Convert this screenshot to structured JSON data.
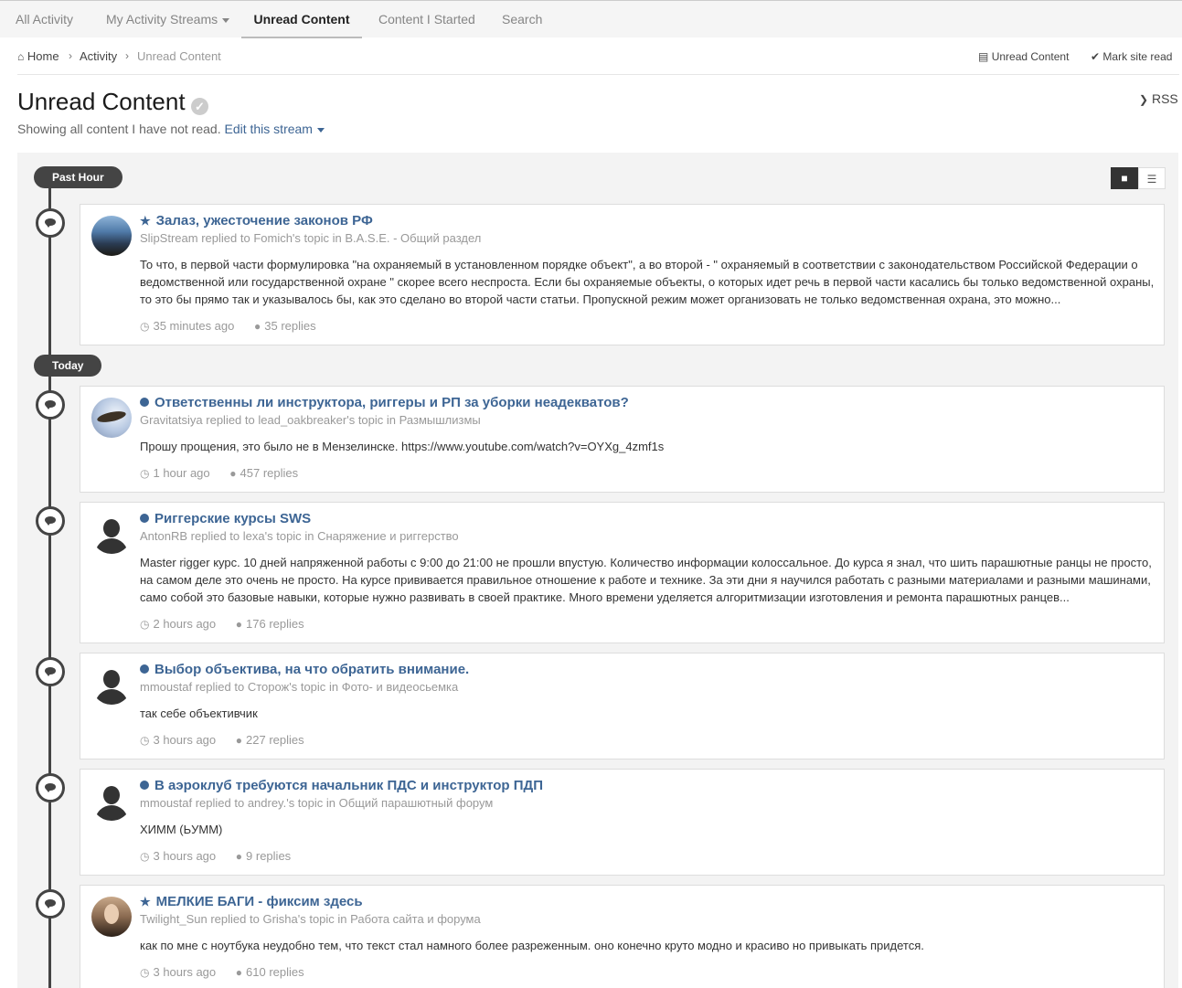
{
  "tabs": [
    {
      "label": "All Activity"
    },
    {
      "label": "My Activity Streams"
    },
    {
      "label": "Unread Content"
    },
    {
      "label": "Content I Started"
    },
    {
      "label": "Search"
    }
  ],
  "breadcrumb": {
    "home": "Home",
    "activity": "Activity",
    "current": "Unread Content",
    "unread_link": "Unread Content",
    "mark_read": "Mark site read"
  },
  "page": {
    "title": "Unread Content",
    "subtitle": "Showing all content I have not read.",
    "edit_stream": "Edit this stream",
    "rss": "RSS"
  },
  "time_groups": [
    "Past Hour",
    "Today"
  ],
  "items": [
    {
      "title": "Залаз, ужесточение законов РФ",
      "marker": "star",
      "user": "SlipStream",
      "replied": "replied to",
      "topic_owner": "Fomich's topic",
      "in": "in",
      "forum": "B.A.S.E. - Общий раздел",
      "excerpt": "То что, в первой части формулировка  \"на охраняемый в установленном порядке объект\", а во второй - \" охраняемый в соответствии с законодательством Российской Федерации о ведомственной или государственной охране \"  скорее всего неспроста. Если бы охраняемые объекты, о которых идет речь в первой части касались бы только ведомственной охраны, то это бы прямо так и указывалось бы, как это сделано во второй части статьи. Пропускной режим может организовать не только ведомственная охрана, это можно...",
      "time": "35 minutes ago",
      "replies": "35 replies"
    },
    {
      "title": "Ответственны ли инструктора, риггеры и РП за уборки неадекватов?",
      "marker": "dot",
      "user": "Gravitatsiya",
      "replied": "replied to",
      "topic_owner": "lead_oakbreaker's topic",
      "in": "in",
      "forum": "Размышлизмы",
      "excerpt": "Прошу прощения, это было не в Мензелинске.  https://www.youtube.com/watch?v=OYXg_4zmf1s",
      "time": "1 hour ago",
      "replies": "457 replies"
    },
    {
      "title": "Риггерские курсы SWS",
      "marker": "dot",
      "user": "AntonRB",
      "replied": "replied to",
      "topic_owner": "lexa's topic",
      "in": "in",
      "forum": "Снаряжение и риггерство",
      "excerpt": "Master rigger курс. 10 дней напряженной работы с 9:00 до 21:00 не прошли впустую. Количество информации колоссальное. До курса я знал, что шить парашютные ранцы не просто, на самом деле это очень не просто. На курсе прививается правильное отношение к работе и технике. За эти дни я научился работать с разными материалами и разными машинами, само собой это базовые навыки, которые нужно развивать в своей практике. Много времени уделяется алгоритмизации изготовления и ремонта парашютных ранцев...",
      "time": "2 hours ago",
      "replies": "176 replies"
    },
    {
      "title": "Выбор объектива, на что обратить внимание.",
      "marker": "dot",
      "user": "mmoustaf",
      "replied": "replied to",
      "topic_owner": "Сторож's topic",
      "in": "in",
      "forum": "Фото- и видеосьемка",
      "excerpt": "так себе объективчик",
      "time": "3 hours ago",
      "replies": "227 replies"
    },
    {
      "title": "В аэроклуб требуются начальник ПДС и инструктор ПДП",
      "marker": "dot",
      "user": "mmoustaf",
      "replied": "replied to",
      "topic_owner": "andrey.'s topic",
      "in": "in",
      "forum": "Общий парашютный форум",
      "excerpt": "ХИММ (ЬУММ)",
      "time": "3 hours ago",
      "replies": "9 replies"
    },
    {
      "title": "МЕЛКИЕ БАГИ - фиксим здесь",
      "marker": "star",
      "user": "Twilight_Sun",
      "replied": "replied to",
      "topic_owner": "Grisha's topic",
      "in": "in",
      "forum": "Работа сайта и форума",
      "excerpt": "как по мне с ноутбука неудобно тем, что текст стал намного более разреженным. оно конечно круто модно и красиво но привыкать придется.",
      "time": "3 hours ago",
      "replies": "610 replies"
    }
  ],
  "colors": {
    "link": "#3d6594",
    "timeline": "#444444",
    "muted": "#999999"
  }
}
